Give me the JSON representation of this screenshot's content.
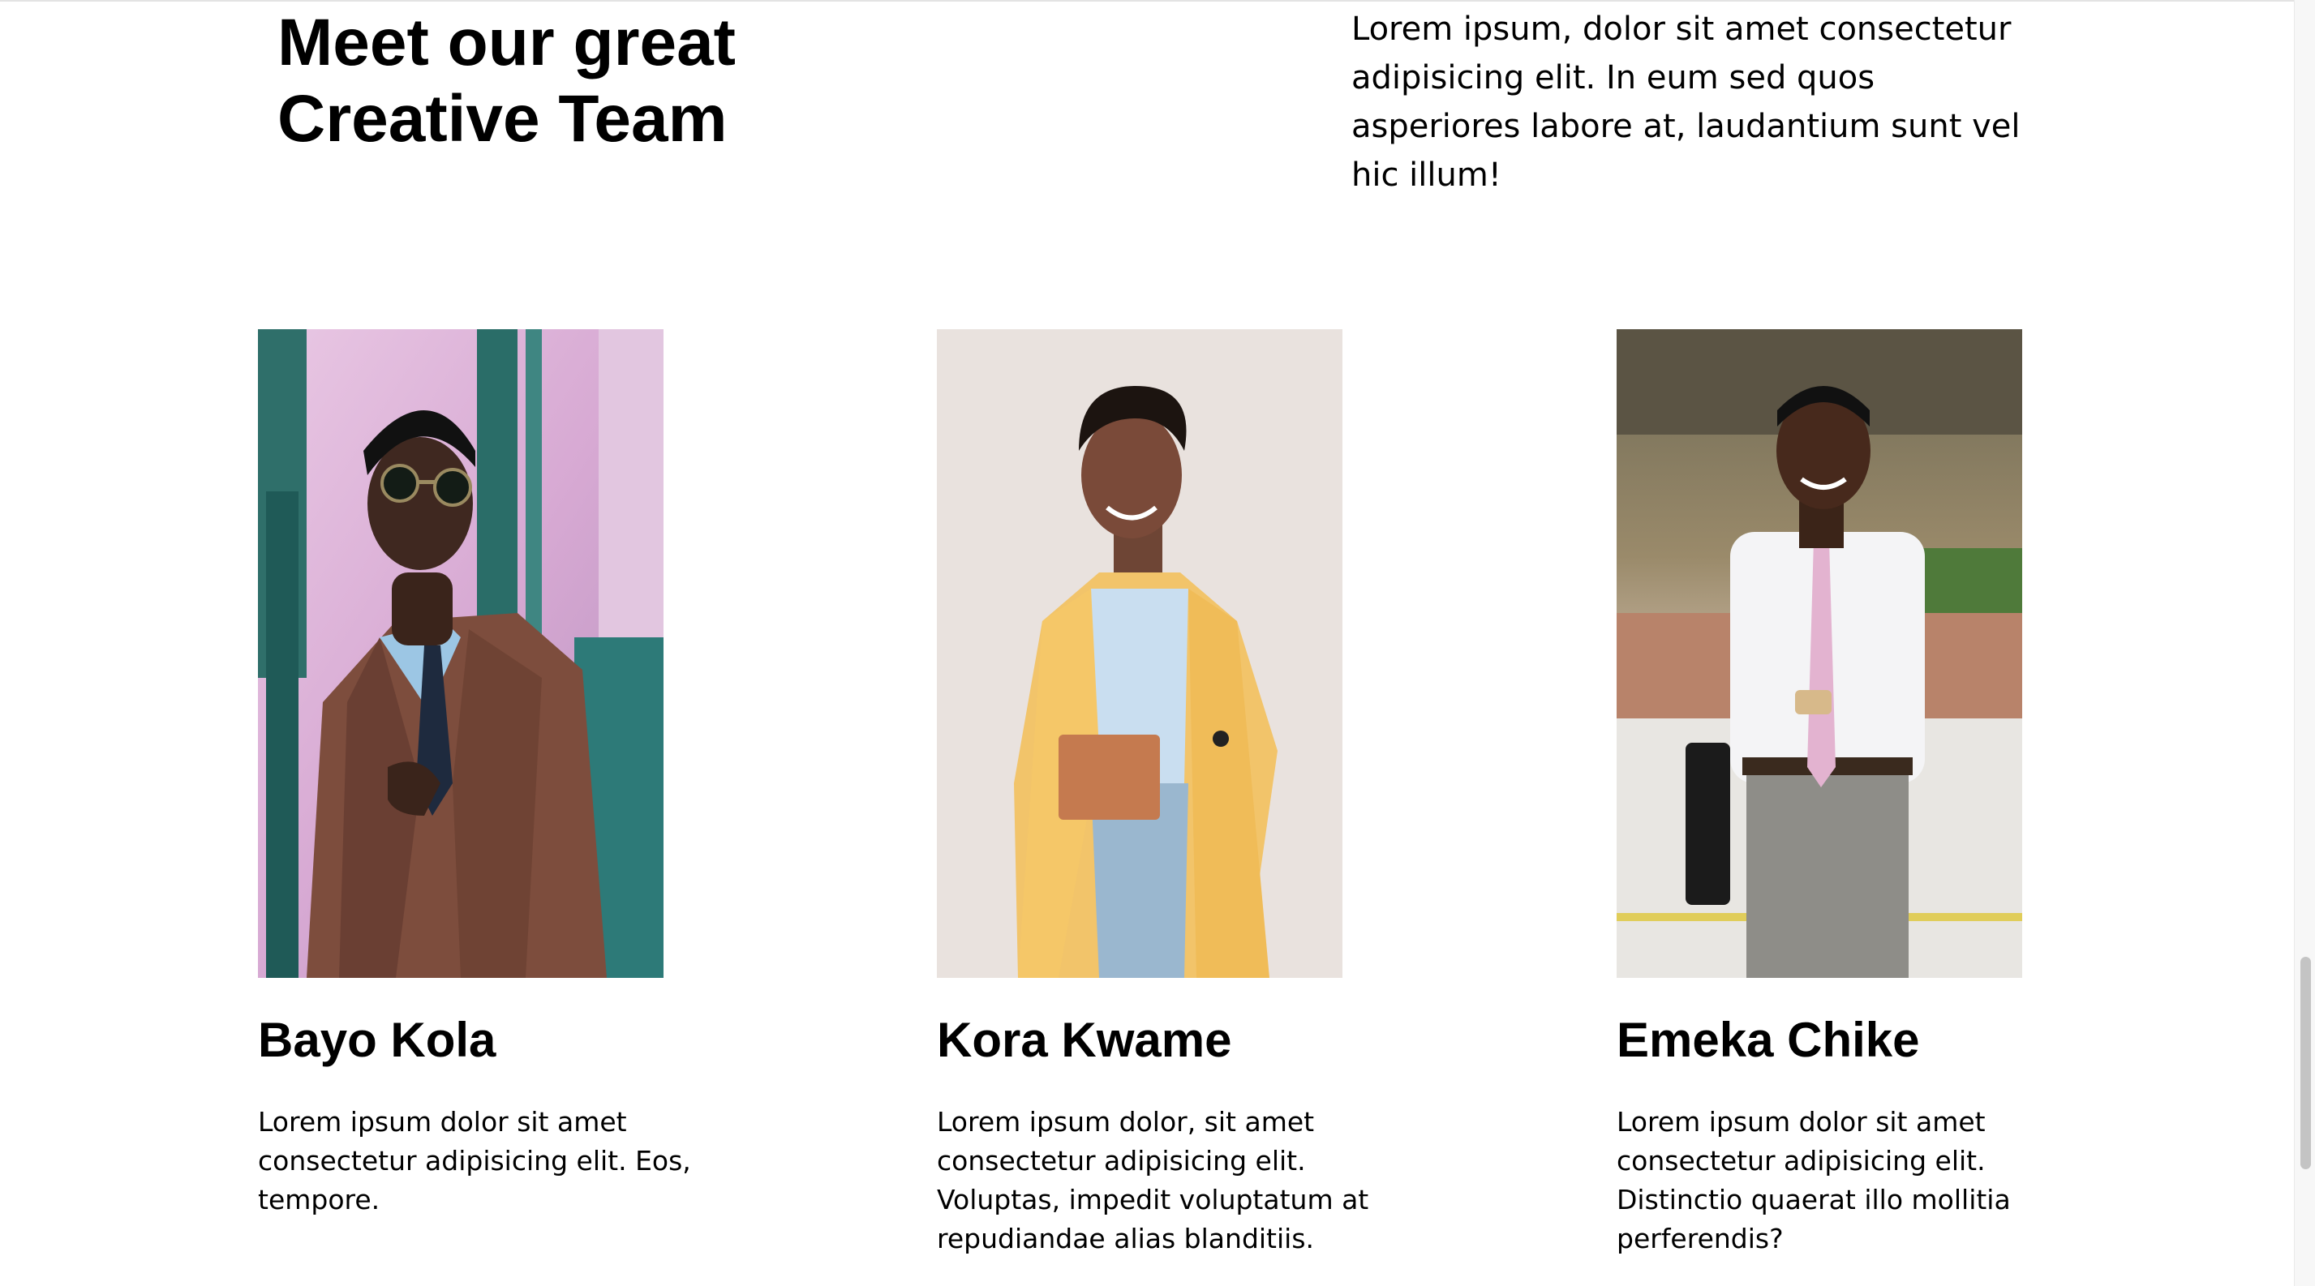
{
  "header": {
    "title_line1": "Meet our great",
    "title_line2": "Creative Team",
    "intro": "Lorem ipsum, dolor sit amet consectetur adipisicing elit. In eum sed quos asperiores labore at, laudantium sunt vel hic illum!"
  },
  "team": [
    {
      "name": "Bayo Kola",
      "bio": "Lorem ipsum dolor sit amet consectetur adipisicing elit. Eos, tempore."
    },
    {
      "name": "Kora Kwame",
      "bio": "Lorem ipsum dolor, sit amet consectetur adipisicing elit. Voluptas, impedit voluptatum at repudiandae alias blanditiis."
    },
    {
      "name": "Emeka Chike",
      "bio": "Lorem ipsum dolor sit amet consectetur adipisicing elit. Distinctio quaerat illo mollitia perferendis?"
    }
  ],
  "colors": {
    "text": "#000000",
    "background": "#ffffff"
  }
}
